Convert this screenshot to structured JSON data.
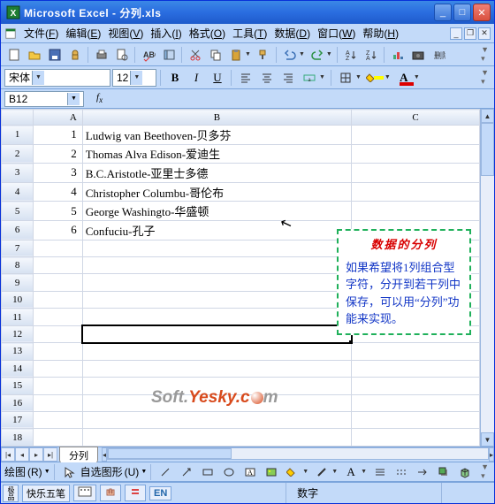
{
  "window": {
    "title": "Microsoft Excel - 分列.xls"
  },
  "menubar": {
    "items": [
      {
        "label": "文件",
        "key": "F"
      },
      {
        "label": "编辑",
        "key": "E"
      },
      {
        "label": "视图",
        "key": "V"
      },
      {
        "label": "插入",
        "key": "I"
      },
      {
        "label": "格式",
        "key": "O"
      },
      {
        "label": "工具",
        "key": "T"
      },
      {
        "label": "数据",
        "key": "D"
      },
      {
        "label": "窗口",
        "key": "W"
      },
      {
        "label": "帮助",
        "key": "H"
      }
    ]
  },
  "format": {
    "font_name": "宋体",
    "font_size": "12"
  },
  "namebox": {
    "ref": "B12",
    "formula": ""
  },
  "columns": [
    "A",
    "B",
    "C"
  ],
  "rows": [
    {
      "n": "1",
      "a": "1",
      "b": "Ludwig van Beethoven-贝多芬"
    },
    {
      "n": "2",
      "a": "2",
      "b": "Thomas Alva Edison-爱迪生"
    },
    {
      "n": "3",
      "a": "3",
      "b": "B.C.Aristotle-亚里士多德"
    },
    {
      "n": "4",
      "a": "4",
      "b": "Christopher Columbu-哥伦布"
    },
    {
      "n": "5",
      "a": "5",
      "b": "George Washingto-华盛顿"
    },
    {
      "n": "6",
      "a": "6",
      "b": "Confuciu-孔子"
    },
    {
      "n": "7",
      "a": "",
      "b": ""
    },
    {
      "n": "8",
      "a": "",
      "b": ""
    },
    {
      "n": "9",
      "a": "",
      "b": ""
    },
    {
      "n": "10",
      "a": "",
      "b": ""
    },
    {
      "n": "11",
      "a": "",
      "b": ""
    },
    {
      "n": "12",
      "a": "",
      "b": ""
    },
    {
      "n": "13",
      "a": "",
      "b": ""
    },
    {
      "n": "14",
      "a": "",
      "b": ""
    },
    {
      "n": "15",
      "a": "",
      "b": ""
    },
    {
      "n": "16",
      "a": "",
      "b": ""
    },
    {
      "n": "17",
      "a": "",
      "b": ""
    },
    {
      "n": "18",
      "a": "",
      "b": ""
    }
  ],
  "callout": {
    "title": "数据的分列",
    "body": "如果希望将1列组合型字符，分开到若干列中保存，可以用“分列”功能来实现。"
  },
  "watermark": {
    "part1": "Soft.",
    "part2": "Yesky.c",
    "part3": "m"
  },
  "sheettabs": {
    "active": "分列"
  },
  "drawbar": {
    "draw": "绘图",
    "autoshape": "自选图形"
  },
  "statusbar": {
    "ime_brand": "极品",
    "ime_name": "快乐五笔",
    "mode": "数字"
  }
}
